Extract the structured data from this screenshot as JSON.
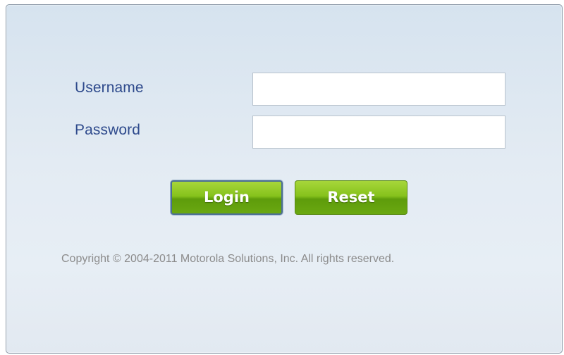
{
  "form": {
    "username_label": "Username",
    "username_value": "",
    "password_label": "Password",
    "password_value": ""
  },
  "buttons": {
    "login_label": "Login",
    "reset_label": "Reset"
  },
  "footer": {
    "copyright": "Copyright © 2004-2011 Motorola Solutions, Inc. All rights reserved."
  },
  "colors": {
    "label_text": "#2e4a8c",
    "button_green": "#86c21c",
    "copyright_text": "#8c8c8c",
    "panel_background": "#dfe8f1"
  }
}
